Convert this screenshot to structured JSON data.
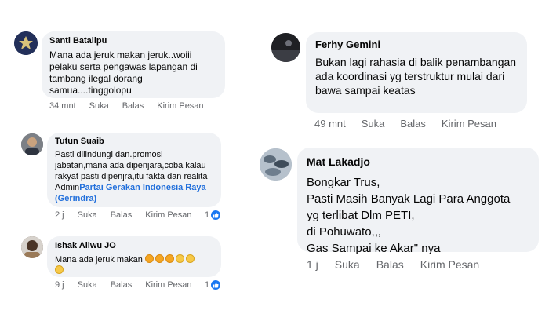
{
  "comments": [
    {
      "author": "Santi Batalipu",
      "text": "Mana ada jeruk makan jeruk..woiii pelaku serta pengawas lapangan di tambang ilegal dorang samua....tinggolopu",
      "time": "34 mnt",
      "like": "Suka",
      "reply": "Balas",
      "message": "Kirim Pesan"
    },
    {
      "author": "Tutun Suaib",
      "text": "Pasti dilindungi dan.promosi jabatan,mana ada dipenjara,coba kalau rakyat pasti dipenjra,itu fakta dan realita Admin",
      "link": "Partai Gerakan Indonesia Raya (Gerindra)",
      "time": "2 j",
      "like": "Suka",
      "reply": "Balas",
      "message": "Kirim Pesan",
      "reactions": "1"
    },
    {
      "author": "Ishak Aliwu JO",
      "text": "Mana ada jeruk makan",
      "emojis": [
        "orange",
        "orange",
        "orange",
        "laugh",
        "laugh",
        "laugh"
      ],
      "time": "9 j",
      "like": "Suka",
      "reply": "Balas",
      "message": "Kirim Pesan",
      "reactions": "1"
    },
    {
      "author": "Ferhy Gemini",
      "text": "Bukan lagi rahasia di balik penambangan ada koordinasi yg terstruktur mulai dari bawa sampai keatas",
      "time": "49 mnt",
      "like": "Suka",
      "reply": "Balas",
      "message": "Kirim Pesan"
    },
    {
      "author": "Mat Lakadjo",
      "lines": [
        "Bongkar Trus,",
        "Pasti Masih Banyak Lagi Para Anggota",
        "yg terlibat Dlm PETI,",
        "di Pohuwato,,,",
        "Gas Sampai ke Akar\" nya"
      ],
      "time": "1 j",
      "like": "Suka",
      "reply": "Balas",
      "message": "Kirim Pesan"
    }
  ],
  "colors": {
    "bubble": "#f0f2f5",
    "link": "#216fdb",
    "meta": "#65676b",
    "like_badge": "#1877f2"
  },
  "icons": {
    "reaction": "like-thumb-icon"
  }
}
